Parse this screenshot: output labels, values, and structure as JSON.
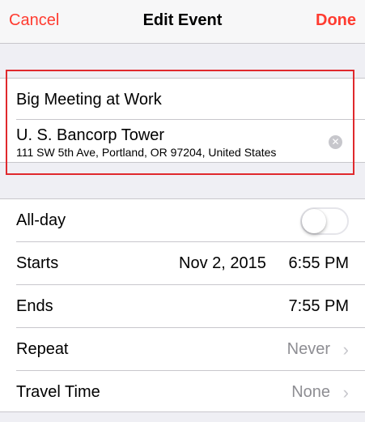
{
  "navbar": {
    "cancel_label": "Cancel",
    "title": "Edit Event",
    "done_label": "Done"
  },
  "event": {
    "title": "Big Meeting at Work",
    "location_name": "U. S. Bancorp Tower",
    "location_address": "111 SW 5th Ave, Portland, OR  97204, United States",
    "clear_icon": "clear-icon"
  },
  "details": {
    "allday_label": "All-day",
    "allday_on": false,
    "starts_label": "Starts",
    "starts_date": "Nov 2, 2015",
    "starts_time": "6:55 PM",
    "ends_label": "Ends",
    "ends_time": "7:55 PM",
    "repeat_label": "Repeat",
    "repeat_value": "Never",
    "travel_label": "Travel Time",
    "travel_value": "None"
  },
  "colors": {
    "accent": "#ff3b30",
    "highlight_box": "#e0292d"
  }
}
